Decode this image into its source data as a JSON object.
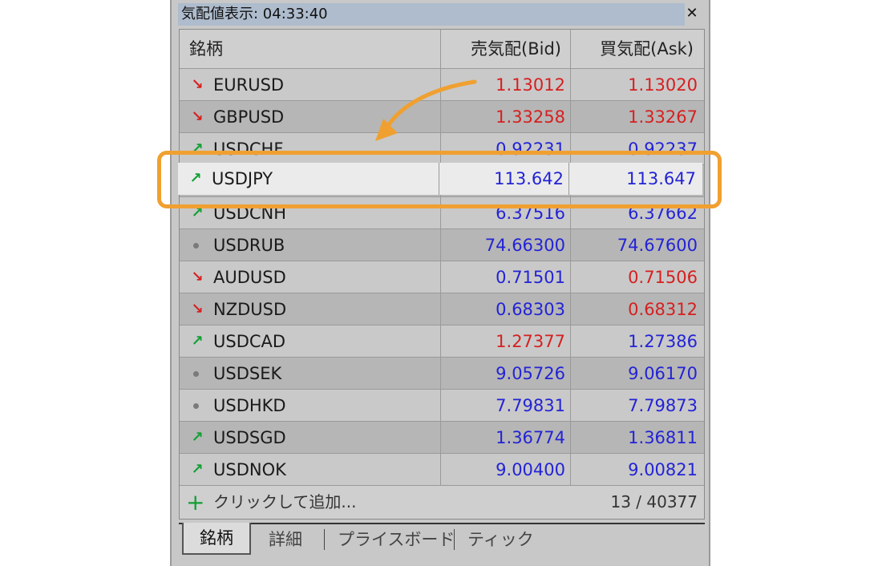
{
  "window": {
    "title": "気配値表示: 04:33:40",
    "close_icon": "close-icon"
  },
  "header": {
    "symbol": "銘柄",
    "bid": "売気配(Bid)",
    "ask": "買気配(Ask)"
  },
  "colors": {
    "up": "#11a033",
    "down": "#d62020",
    "blue": "#2323d6",
    "red": "#d62020",
    "highlight": "#f0a030",
    "dot": "#7a7a7a"
  },
  "rows": [
    {
      "symbol": "EURUSD",
      "dir": "down",
      "bid": "1.13012",
      "bid_color": "red",
      "ask": "1.13020",
      "ask_color": "red"
    },
    {
      "symbol": "GBPUSD",
      "dir": "down",
      "bid": "1.33258",
      "bid_color": "red",
      "ask": "1.33267",
      "ask_color": "red"
    },
    {
      "symbol": "USDCHF",
      "dir": "up",
      "bid": "0.92231",
      "bid_color": "blue",
      "ask": "0.92237",
      "ask_color": "blue"
    },
    {
      "symbol": "USDJPY",
      "dir": "up",
      "bid": "113.642",
      "bid_color": "blue",
      "ask": "113.647",
      "ask_color": "blue"
    },
    {
      "symbol": "USDCNH",
      "dir": "up",
      "bid": "6.37516",
      "bid_color": "blue",
      "ask": "6.37662",
      "ask_color": "blue"
    },
    {
      "symbol": "USDRUB",
      "dir": "none",
      "bid": "74.66300",
      "bid_color": "blue",
      "ask": "74.67600",
      "ask_color": "blue"
    },
    {
      "symbol": "AUDUSD",
      "dir": "down",
      "bid": "0.71501",
      "bid_color": "blue",
      "ask": "0.71506",
      "ask_color": "red"
    },
    {
      "symbol": "NZDUSD",
      "dir": "down",
      "bid": "0.68303",
      "bid_color": "blue",
      "ask": "0.68312",
      "ask_color": "red"
    },
    {
      "symbol": "USDCAD",
      "dir": "up",
      "bid": "1.27377",
      "bid_color": "red",
      "ask": "1.27386",
      "ask_color": "blue"
    },
    {
      "symbol": "USDSEK",
      "dir": "none",
      "bid": "9.05726",
      "bid_color": "blue",
      "ask": "9.06170",
      "ask_color": "blue"
    },
    {
      "symbol": "USDHKD",
      "dir": "none",
      "bid": "7.79831",
      "bid_color": "blue",
      "ask": "7.79873",
      "ask_color": "blue"
    },
    {
      "symbol": "USDSGD",
      "dir": "up",
      "bid": "1.36774",
      "bid_color": "blue",
      "ask": "1.36811",
      "ask_color": "blue"
    },
    {
      "symbol": "USDNOK",
      "dir": "up",
      "bid": "9.00400",
      "bid_color": "blue",
      "ask": "9.00821",
      "ask_color": "blue"
    }
  ],
  "add_row": {
    "label": "クリックして追加...",
    "count": "13 / 40377",
    "icon": "plus-icon"
  },
  "tabs": [
    "銘柄",
    "詳細",
    "プライスボード",
    "ティック"
  ],
  "highlight": {
    "symbol": "USDJPY"
  }
}
